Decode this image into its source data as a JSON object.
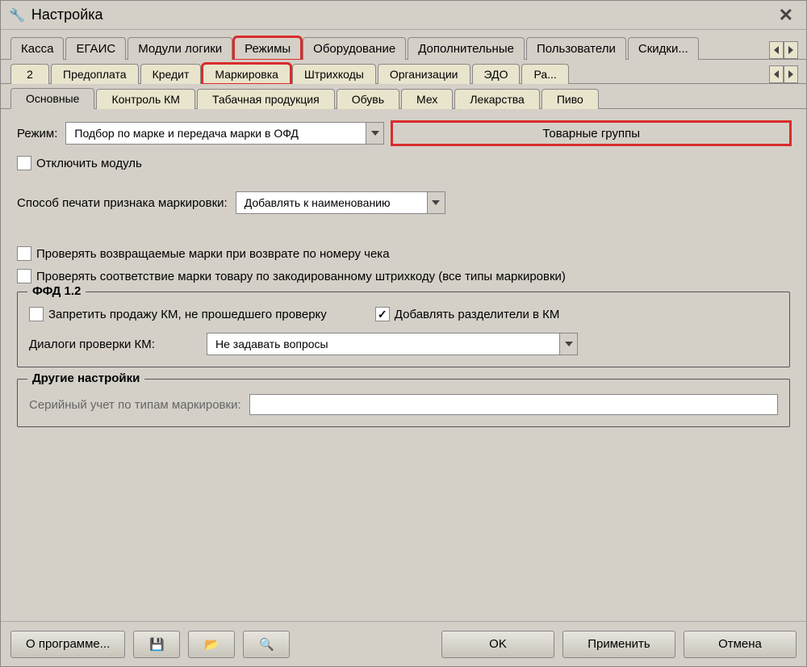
{
  "window": {
    "title": "Настройка"
  },
  "menu": {
    "items": [
      "Касса",
      "ЕГАИС",
      "Модули логики",
      "Режимы",
      "Оборудование",
      "Дополнительные",
      "Пользователи",
      "Скидки..."
    ],
    "highlighted_index": 3
  },
  "tabs_level2": {
    "items": [
      "2",
      "Предоплата",
      "Кредит",
      "Маркировка",
      "Штрихкоды",
      "Организации",
      "ЭДО",
      "Ра..."
    ],
    "highlighted_index": 3
  },
  "tabs_level3": {
    "items": [
      "Основные",
      "Контроль КМ",
      "Табачная продукция",
      "Обувь",
      "Мех",
      "Лекарства",
      "Пиво"
    ],
    "active_index": 0
  },
  "form": {
    "mode_label": "Режим:",
    "mode_value": "Подбор по марке и передача марки в ОФД",
    "groups_button": "Товарные группы",
    "disable_module_label": "Отключить модуль",
    "disable_module_checked": false,
    "print_method_label": "Способ печати признака маркировки:",
    "print_method_value": "Добавлять к наименованию",
    "check_returned_label": "Проверять возвращаемые марки при возврате по номеру чека",
    "check_returned_checked": false,
    "check_match_label": "Проверять соответствие марки товару по закодированному штрихкоду (все типы маркировки)",
    "check_match_checked": false
  },
  "ffd": {
    "legend": "ФФД 1.2",
    "forbid_label": "Запретить продажу КМ, не прошедшего проверку",
    "forbid_checked": false,
    "add_sep_label": "Добавлять разделители в КМ",
    "add_sep_checked": true,
    "dialogs_label": "Диалоги проверки КМ:",
    "dialogs_value": "Не задавать вопросы"
  },
  "other": {
    "legend": "Другие настройки",
    "serial_label": "Серийный учет по типам маркировки:",
    "serial_value": ""
  },
  "bottom": {
    "about": "О программе...",
    "ok": "OK",
    "apply": "Применить",
    "cancel": "Отмена"
  }
}
